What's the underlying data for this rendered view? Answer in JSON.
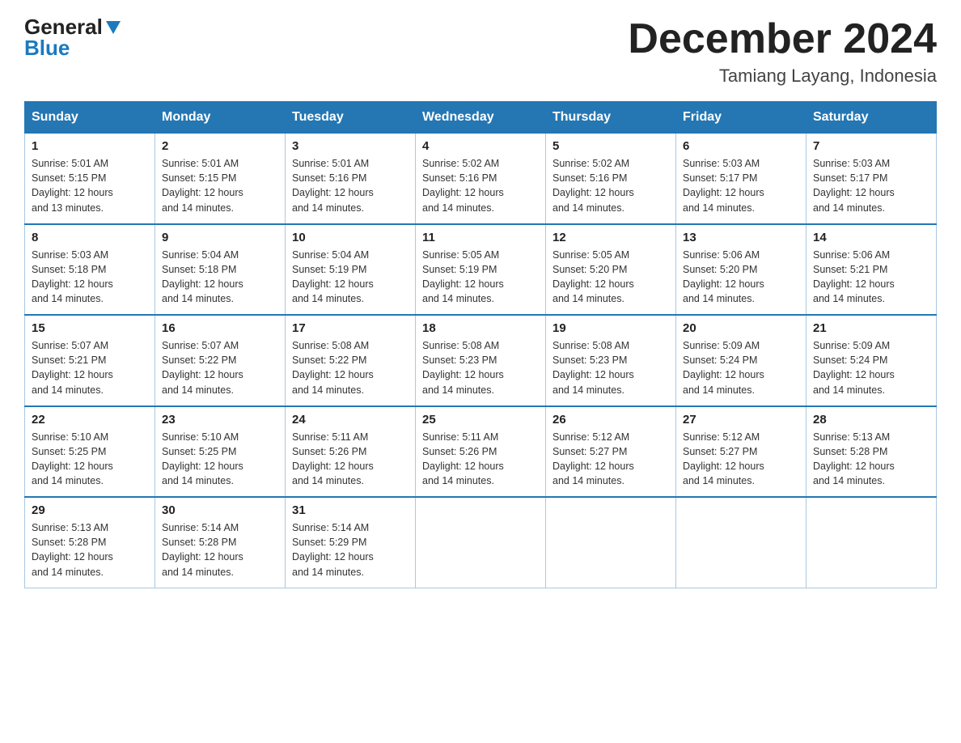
{
  "logo": {
    "general": "General",
    "blue": "Blue"
  },
  "header": {
    "month": "December 2024",
    "location": "Tamiang Layang, Indonesia"
  },
  "weekdays": [
    "Sunday",
    "Monday",
    "Tuesday",
    "Wednesday",
    "Thursday",
    "Friday",
    "Saturday"
  ],
  "weeks": [
    [
      {
        "day": "1",
        "sunrise": "5:01 AM",
        "sunset": "5:15 PM",
        "daylight": "12 hours and 13 minutes."
      },
      {
        "day": "2",
        "sunrise": "5:01 AM",
        "sunset": "5:15 PM",
        "daylight": "12 hours and 14 minutes."
      },
      {
        "day": "3",
        "sunrise": "5:01 AM",
        "sunset": "5:16 PM",
        "daylight": "12 hours and 14 minutes."
      },
      {
        "day": "4",
        "sunrise": "5:02 AM",
        "sunset": "5:16 PM",
        "daylight": "12 hours and 14 minutes."
      },
      {
        "day": "5",
        "sunrise": "5:02 AM",
        "sunset": "5:16 PM",
        "daylight": "12 hours and 14 minutes."
      },
      {
        "day": "6",
        "sunrise": "5:03 AM",
        "sunset": "5:17 PM",
        "daylight": "12 hours and 14 minutes."
      },
      {
        "day": "7",
        "sunrise": "5:03 AM",
        "sunset": "5:17 PM",
        "daylight": "12 hours and 14 minutes."
      }
    ],
    [
      {
        "day": "8",
        "sunrise": "5:03 AM",
        "sunset": "5:18 PM",
        "daylight": "12 hours and 14 minutes."
      },
      {
        "day": "9",
        "sunrise": "5:04 AM",
        "sunset": "5:18 PM",
        "daylight": "12 hours and 14 minutes."
      },
      {
        "day": "10",
        "sunrise": "5:04 AM",
        "sunset": "5:19 PM",
        "daylight": "12 hours and 14 minutes."
      },
      {
        "day": "11",
        "sunrise": "5:05 AM",
        "sunset": "5:19 PM",
        "daylight": "12 hours and 14 minutes."
      },
      {
        "day": "12",
        "sunrise": "5:05 AM",
        "sunset": "5:20 PM",
        "daylight": "12 hours and 14 minutes."
      },
      {
        "day": "13",
        "sunrise": "5:06 AM",
        "sunset": "5:20 PM",
        "daylight": "12 hours and 14 minutes."
      },
      {
        "day": "14",
        "sunrise": "5:06 AM",
        "sunset": "5:21 PM",
        "daylight": "12 hours and 14 minutes."
      }
    ],
    [
      {
        "day": "15",
        "sunrise": "5:07 AM",
        "sunset": "5:21 PM",
        "daylight": "12 hours and 14 minutes."
      },
      {
        "day": "16",
        "sunrise": "5:07 AM",
        "sunset": "5:22 PM",
        "daylight": "12 hours and 14 minutes."
      },
      {
        "day": "17",
        "sunrise": "5:08 AM",
        "sunset": "5:22 PM",
        "daylight": "12 hours and 14 minutes."
      },
      {
        "day": "18",
        "sunrise": "5:08 AM",
        "sunset": "5:23 PM",
        "daylight": "12 hours and 14 minutes."
      },
      {
        "day": "19",
        "sunrise": "5:08 AM",
        "sunset": "5:23 PM",
        "daylight": "12 hours and 14 minutes."
      },
      {
        "day": "20",
        "sunrise": "5:09 AM",
        "sunset": "5:24 PM",
        "daylight": "12 hours and 14 minutes."
      },
      {
        "day": "21",
        "sunrise": "5:09 AM",
        "sunset": "5:24 PM",
        "daylight": "12 hours and 14 minutes."
      }
    ],
    [
      {
        "day": "22",
        "sunrise": "5:10 AM",
        "sunset": "5:25 PM",
        "daylight": "12 hours and 14 minutes."
      },
      {
        "day": "23",
        "sunrise": "5:10 AM",
        "sunset": "5:25 PM",
        "daylight": "12 hours and 14 minutes."
      },
      {
        "day": "24",
        "sunrise": "5:11 AM",
        "sunset": "5:26 PM",
        "daylight": "12 hours and 14 minutes."
      },
      {
        "day": "25",
        "sunrise": "5:11 AM",
        "sunset": "5:26 PM",
        "daylight": "12 hours and 14 minutes."
      },
      {
        "day": "26",
        "sunrise": "5:12 AM",
        "sunset": "5:27 PM",
        "daylight": "12 hours and 14 minutes."
      },
      {
        "day": "27",
        "sunrise": "5:12 AM",
        "sunset": "5:27 PM",
        "daylight": "12 hours and 14 minutes."
      },
      {
        "day": "28",
        "sunrise": "5:13 AM",
        "sunset": "5:28 PM",
        "daylight": "12 hours and 14 minutes."
      }
    ],
    [
      {
        "day": "29",
        "sunrise": "5:13 AM",
        "sunset": "5:28 PM",
        "daylight": "12 hours and 14 minutes."
      },
      {
        "day": "30",
        "sunrise": "5:14 AM",
        "sunset": "5:28 PM",
        "daylight": "12 hours and 14 minutes."
      },
      {
        "day": "31",
        "sunrise": "5:14 AM",
        "sunset": "5:29 PM",
        "daylight": "12 hours and 14 minutes."
      },
      null,
      null,
      null,
      null
    ]
  ],
  "labels": {
    "sunrise_prefix": "Sunrise: ",
    "sunset_prefix": "Sunset: ",
    "daylight_prefix": "Daylight: "
  }
}
